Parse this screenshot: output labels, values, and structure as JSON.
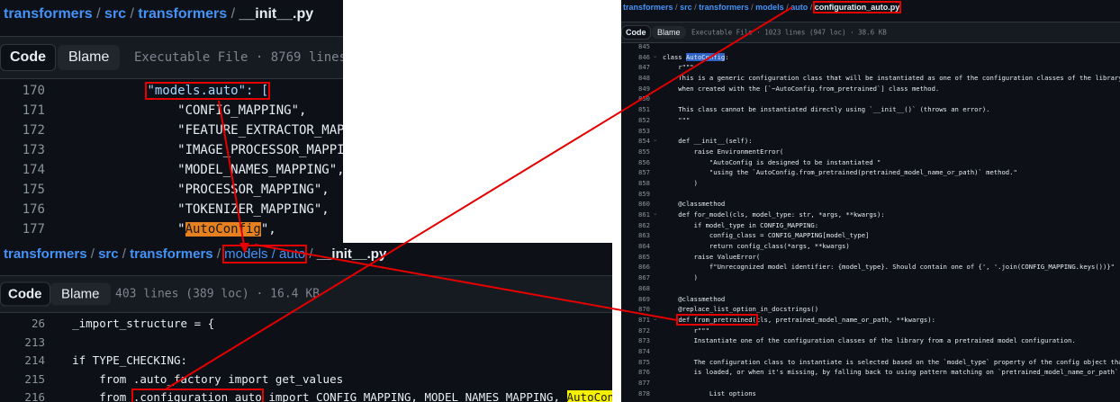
{
  "panel1": {
    "breadcrumb": [
      "transformers",
      "src",
      "transformers"
    ],
    "file": "__init__.py",
    "tabs": {
      "code": "Code",
      "blame": "Blame"
    },
    "meta": "Executable File · 8769 lines",
    "lines": [
      {
        "n": "170",
        "pre": "        ",
        "hl": "\"models.auto\": [",
        "post": ""
      },
      {
        "n": "171",
        "text": "            \"CONFIG_MAPPING\","
      },
      {
        "n": "172",
        "text": "            \"FEATURE_EXTRACTOR_MAPPING\","
      },
      {
        "n": "173",
        "text": "            \"IMAGE_PROCESSOR_MAPPING\","
      },
      {
        "n": "174",
        "text": "            \"MODEL_NAMES_MAPPING\","
      },
      {
        "n": "175",
        "text": "            \"PROCESSOR_MAPPING\","
      },
      {
        "n": "176",
        "text": "            \"TOKENIZER_MAPPING\","
      },
      {
        "n": "177",
        "pre": "            \"",
        "hl": "AutoConfig",
        "post": "\","
      }
    ]
  },
  "panel2": {
    "breadcrumb": [
      "transformers",
      "src",
      "transformers"
    ],
    "boxed": "models / auto",
    "file": "__init__.py",
    "tabs": {
      "code": "Code",
      "blame": "Blame"
    },
    "meta": "403 lines (389 loc) · 16.4 KB",
    "lines": [
      {
        "n": "26",
        "text": "    _import_structure = {"
      },
      {
        "n": "213",
        "text": ""
      },
      {
        "n": "214",
        "text": "    if TYPE_CHECKING:"
      },
      {
        "n": "215",
        "text": "        from .auto_factory import get_values"
      },
      {
        "n": "216",
        "pre": "        from ",
        "box": ".configuration_auto",
        "mid": " import CONFIG_MAPPING, MODEL_NAMES_MAPPING, ",
        "hl": "AutoConfig"
      }
    ]
  },
  "panel3": {
    "breadcrumb": [
      "transformers",
      "src",
      "transformers",
      "models",
      "auto"
    ],
    "file": "configuration_auto.py",
    "tabs": {
      "code": "Code",
      "blame": "Blame"
    },
    "meta": "Executable File · 1023 lines (947 loc) · 38.6 KB",
    "lines": [
      {
        "n": "845",
        "text": ""
      },
      {
        "n": "846",
        "chev": true,
        "pre": "class ",
        "hl": "AutoConfig",
        "post": ":"
      },
      {
        "n": "847",
        "text": "    r\"\"\""
      },
      {
        "n": "848",
        "text": "    This is a generic configuration class that will be instantiated as one of the configuration classes of the library"
      },
      {
        "n": "849",
        "text": "    when created with the [`~AutoConfig.from_pretrained`] class method."
      },
      {
        "n": "850",
        "text": ""
      },
      {
        "n": "851",
        "text": "    This class cannot be instantiated directly using `__init__()` (throws an error)."
      },
      {
        "n": "852",
        "text": "    \"\"\""
      },
      {
        "n": "853",
        "text": ""
      },
      {
        "n": "854",
        "chev": true,
        "text": "    def __init__(self):"
      },
      {
        "n": "855",
        "text": "        raise EnvironmentError("
      },
      {
        "n": "856",
        "text": "            \"AutoConfig is designed to be instantiated \""
      },
      {
        "n": "857",
        "text": "            \"using the `AutoConfig.from_pretrained(pretrained_model_name_or_path)` method.\""
      },
      {
        "n": "858",
        "text": "        )"
      },
      {
        "n": "859",
        "text": ""
      },
      {
        "n": "860",
        "text": "    @classmethod"
      },
      {
        "n": "861",
        "chev": true,
        "text": "    def for_model(cls, model_type: str, *args, **kwargs):"
      },
      {
        "n": "862",
        "text": "        if model_type in CONFIG_MAPPING:"
      },
      {
        "n": "863",
        "text": "            config_class = CONFIG_MAPPING[model_type]"
      },
      {
        "n": "864",
        "text": "            return config_class(*args, **kwargs)"
      },
      {
        "n": "865",
        "text": "        raise ValueError("
      },
      {
        "n": "866",
        "text": "            f\"Unrecognized model identifier: {model_type}. Should contain one of {', '.join(CONFIG_MAPPING.keys())}\""
      },
      {
        "n": "867",
        "text": "        )"
      },
      {
        "n": "868",
        "text": ""
      },
      {
        "n": "869",
        "text": "    @classmethod"
      },
      {
        "n": "870",
        "text": "    @replace_list_option_in_docstrings()"
      },
      {
        "n": "871",
        "chev": true,
        "pre": "    ",
        "box": "def from_pretrained(",
        "post": "cls, pretrained_model_name_or_path, **kwargs):"
      },
      {
        "n": "872",
        "text": "        r\"\"\""
      },
      {
        "n": "873",
        "text": "        Instantiate one of the configuration classes of the library from a pretrained model configuration."
      },
      {
        "n": "874",
        "text": ""
      },
      {
        "n": "875",
        "text": "        The configuration class to instantiate is selected based on the `model_type` property of the config object that"
      },
      {
        "n": "876",
        "text": "        is loaded, or when it's missing, by falling back to using pattern matching on `pretrained_model_name_or_path`:"
      },
      {
        "n": "877",
        "text": ""
      },
      {
        "n": "878",
        "text": "            List options"
      }
    ]
  },
  "colors": {
    "arrow": "#e50000",
    "box": "#e50000",
    "link": "#4493f8"
  }
}
